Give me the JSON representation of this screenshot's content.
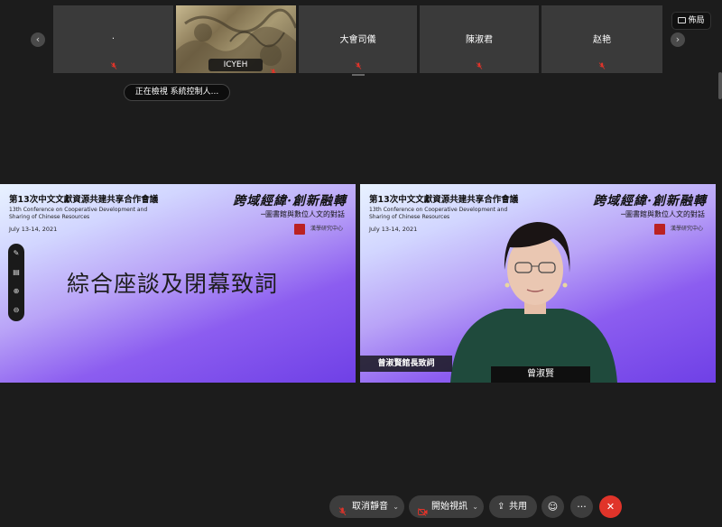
{
  "top_strip": {
    "tiles": [
      {
        "name": "."
      },
      {
        "name": "ICYEH"
      },
      {
        "name": "大會司儀"
      },
      {
        "name": "陳淑君"
      },
      {
        "name": "赵艳"
      }
    ],
    "layout_label": "佈局"
  },
  "viewing_status": "正在檢視 系統控制人...",
  "slide": {
    "title_cn": "第13次中文文獻資源共建共享合作會議",
    "subtitle_en": "13th Conference on Cooperative Development and Sharing of Chinese Resources",
    "date": "July 13-14, 2021",
    "calligraphy": "跨域經緯·創新融轉",
    "tagline": "─圖書館與數位人文的對話",
    "org": "漢學研究中心",
    "org_en": "Center for Chinese Studies",
    "main_text": "綜合座談及閉幕致詞"
  },
  "speaker": {
    "caption": "曾淑賢館長致詞",
    "name": "曾淑賢"
  },
  "toolbar": {
    "unmute": "取消靜音",
    "start_video": "開始視訊",
    "share": "共用"
  },
  "colors": {
    "background": "#1c1c1c",
    "tile": "#3a3a3a",
    "muted_mic": "#e0342a",
    "end_call": "#e0342a"
  }
}
